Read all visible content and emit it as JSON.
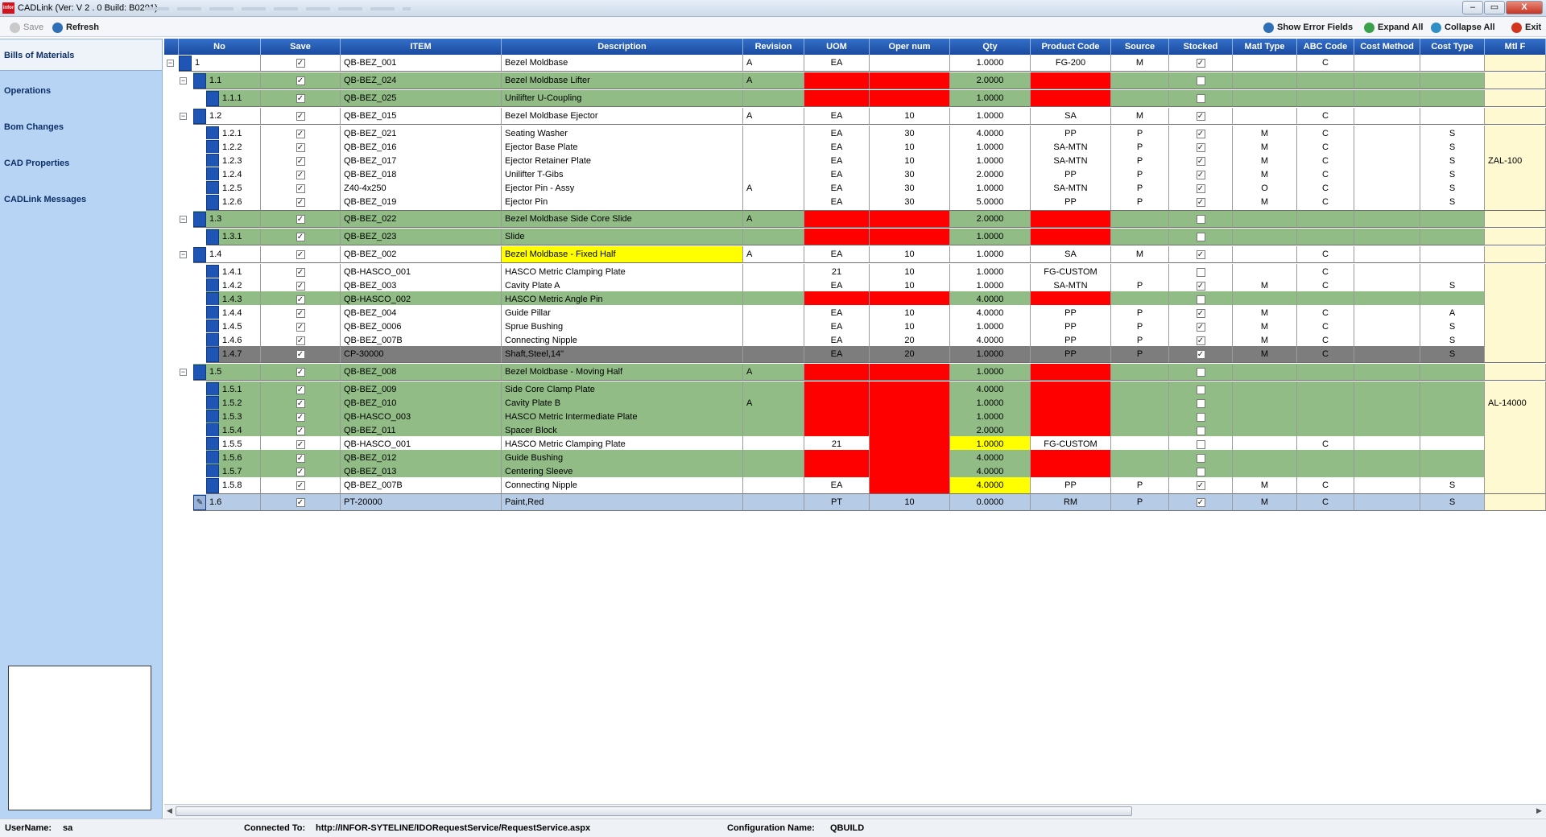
{
  "window": {
    "title": "CADLink  (Ver:  V 2 . 0 Build:  B0201)",
    "logo": "infor",
    "close_label": "X"
  },
  "toolbar": {
    "save": "Save",
    "refresh": "Refresh",
    "show_errors": "Show Error Fields",
    "expand_all": "Expand All",
    "collapse_all": "Collapse All",
    "exit": "Exit"
  },
  "sidebar": {
    "items": [
      "Bills of Materials",
      "Operations",
      "Bom Changes",
      "CAD Properties",
      "CADLink Messages"
    ]
  },
  "columns": [
    "No",
    "Save",
    "ITEM",
    "Description",
    "Revision",
    "UOM",
    "Oper num",
    "Qty",
    "Product Code",
    "Source",
    "Stocked",
    "Matl Type",
    "ABC Code",
    "Cost Method",
    "Cost Type",
    "Mtl F"
  ],
  "rows": [
    {
      "no": "1",
      "lvl": 0,
      "exp": "−",
      "save": true,
      "item": "QB-BEZ_001",
      "desc": "Bezel Moldbase",
      "rev": "A",
      "uom": "EA",
      "oper": "",
      "qty": "1.0000",
      "prod": "FG-200",
      "src": "M",
      "stk": true,
      "matl": "",
      "abc": "C",
      "cm": "",
      "ct": "",
      "mtl": "",
      "bg": "w",
      "err": []
    },
    {
      "no": "1.1",
      "lvl": 1,
      "exp": "−",
      "save": true,
      "item": "QB-BEZ_024",
      "desc": "Bezel Moldbase Lifter",
      "rev": "A",
      "uom": "",
      "oper": "",
      "qty": "2.0000",
      "prod": "",
      "src": "",
      "stk": false,
      "matl": "",
      "abc": "",
      "cm": "",
      "ct": "",
      "mtl": "",
      "bg": "g",
      "err": [
        "uom",
        "oper",
        "prod"
      ]
    },
    {
      "no": "1.1.1",
      "lvl": 2,
      "exp": "",
      "save": true,
      "item": "QB-BEZ_025",
      "desc": "Unilifter U-Coupling",
      "rev": "",
      "uom": "",
      "oper": "",
      "qty": "1.0000",
      "prod": "",
      "src": "",
      "stk": false,
      "matl": "",
      "abc": "",
      "cm": "",
      "ct": "",
      "mtl": "",
      "bg": "g",
      "err": [
        "uom",
        "oper",
        "prod"
      ]
    },
    {
      "no": "1.2",
      "lvl": 1,
      "exp": "−",
      "save": true,
      "item": "QB-BEZ_015",
      "desc": "Bezel Moldbase Ejector",
      "rev": "A",
      "uom": "EA",
      "oper": "10",
      "qty": "1.0000",
      "prod": "SA",
      "src": "M",
      "stk": true,
      "matl": "",
      "abc": "C",
      "cm": "",
      "ct": "",
      "mtl": "",
      "bg": "w",
      "err": []
    },
    {
      "no": "1.2.1",
      "lvl": 2,
      "exp": "",
      "save": true,
      "item": "QB-BEZ_021",
      "desc": "Seating Washer",
      "rev": "",
      "uom": "EA",
      "oper": "30",
      "qty": "4.0000",
      "prod": "PP",
      "src": "P",
      "stk": true,
      "matl": "M",
      "abc": "C",
      "cm": "",
      "ct": "S",
      "mtl": "",
      "bg": "w",
      "err": []
    },
    {
      "no": "1.2.2",
      "lvl": 2,
      "exp": "",
      "save": true,
      "item": "QB-BEZ_016",
      "desc": "Ejector Base Plate",
      "rev": "",
      "uom": "EA",
      "oper": "10",
      "qty": "1.0000",
      "prod": "SA-MTN",
      "src": "P",
      "stk": true,
      "matl": "M",
      "abc": "C",
      "cm": "",
      "ct": "S",
      "mtl": "",
      "bg": "w",
      "err": []
    },
    {
      "no": "1.2.3",
      "lvl": 2,
      "exp": "",
      "save": true,
      "item": "QB-BEZ_017",
      "desc": "Ejector Retainer Plate",
      "rev": "",
      "uom": "EA",
      "oper": "10",
      "qty": "1.0000",
      "prod": "SA-MTN",
      "src": "P",
      "stk": true,
      "matl": "M",
      "abc": "C",
      "cm": "",
      "ct": "S",
      "mtl": "ZAL-100",
      "bg": "w",
      "err": []
    },
    {
      "no": "1.2.4",
      "lvl": 2,
      "exp": "",
      "save": true,
      "item": "QB-BEZ_018",
      "desc": "Unilifter T-Gibs",
      "rev": "",
      "uom": "EA",
      "oper": "30",
      "qty": "2.0000",
      "prod": "PP",
      "src": "P",
      "stk": true,
      "matl": "M",
      "abc": "C",
      "cm": "",
      "ct": "S",
      "mtl": "",
      "bg": "w",
      "err": []
    },
    {
      "no": "1.2.5",
      "lvl": 2,
      "exp": "",
      "save": true,
      "item": "Z40-4x250",
      "desc": "Ejector Pin - Assy",
      "rev": "A",
      "uom": "EA",
      "oper": "30",
      "qty": "1.0000",
      "prod": "SA-MTN",
      "src": "P",
      "stk": true,
      "matl": "O",
      "abc": "C",
      "cm": "",
      "ct": "S",
      "mtl": "",
      "bg": "w",
      "err": []
    },
    {
      "no": "1.2.6",
      "lvl": 2,
      "exp": "",
      "save": true,
      "item": "QB-BEZ_019",
      "desc": "Ejector Pin",
      "rev": "",
      "uom": "EA",
      "oper": "30",
      "qty": "5.0000",
      "prod": "PP",
      "src": "P",
      "stk": true,
      "matl": "M",
      "abc": "C",
      "cm": "",
      "ct": "S",
      "mtl": "",
      "bg": "w",
      "err": []
    },
    {
      "no": "1.3",
      "lvl": 1,
      "exp": "−",
      "save": true,
      "item": "QB-BEZ_022",
      "desc": "Bezel Moldbase Side Core Slide",
      "rev": "A",
      "uom": "",
      "oper": "",
      "qty": "2.0000",
      "prod": "",
      "src": "",
      "stk": false,
      "matl": "",
      "abc": "",
      "cm": "",
      "ct": "",
      "mtl": "",
      "bg": "g",
      "err": [
        "uom",
        "oper",
        "prod"
      ]
    },
    {
      "no": "1.3.1",
      "lvl": 2,
      "exp": "",
      "save": true,
      "item": "QB-BEZ_023",
      "desc": "Slide",
      "rev": "",
      "uom": "",
      "oper": "",
      "qty": "1.0000",
      "prod": "",
      "src": "",
      "stk": false,
      "matl": "",
      "abc": "",
      "cm": "",
      "ct": "",
      "mtl": "",
      "bg": "g",
      "err": [
        "uom",
        "oper",
        "prod"
      ]
    },
    {
      "no": "1.4",
      "lvl": 1,
      "exp": "−",
      "save": true,
      "item": "QB-BEZ_002",
      "desc": "Bezel Moldbase - Fixed Half",
      "rev": "A",
      "uom": "EA",
      "oper": "10",
      "qty": "1.0000",
      "prod": "SA",
      "src": "M",
      "stk": true,
      "matl": "",
      "abc": "C",
      "cm": "",
      "ct": "",
      "mtl": "",
      "bg": "w",
      "err": [],
      "yel": [
        "desc"
      ]
    },
    {
      "no": "1.4.1",
      "lvl": 2,
      "exp": "",
      "save": true,
      "item": "QB-HASCO_001",
      "desc": "HASCO Metric Clamping Plate",
      "rev": "",
      "uom": "21",
      "oper": "10",
      "qty": "1.0000",
      "prod": "FG-CUSTOM",
      "src": "",
      "stk": false,
      "matl": "",
      "abc": "C",
      "cm": "",
      "ct": "",
      "mtl": "",
      "bg": "w",
      "err": []
    },
    {
      "no": "1.4.2",
      "lvl": 2,
      "exp": "",
      "save": true,
      "item": "QB-BEZ_003",
      "desc": "Cavity Plate A",
      "rev": "",
      "uom": "EA",
      "oper": "10",
      "qty": "1.0000",
      "prod": "SA-MTN",
      "src": "P",
      "stk": true,
      "matl": "M",
      "abc": "C",
      "cm": "",
      "ct": "S",
      "mtl": "",
      "bg": "w",
      "err": []
    },
    {
      "no": "1.4.3",
      "lvl": 2,
      "exp": "",
      "save": true,
      "item": "QB-HASCO_002",
      "desc": "HASCO Metric Angle Pin",
      "rev": "",
      "uom": "",
      "oper": "",
      "qty": "4.0000",
      "prod": "",
      "src": "",
      "stk": false,
      "matl": "",
      "abc": "",
      "cm": "",
      "ct": "",
      "mtl": "",
      "bg": "g",
      "err": [
        "uom",
        "oper",
        "prod"
      ]
    },
    {
      "no": "1.4.4",
      "lvl": 2,
      "exp": "",
      "save": true,
      "item": "QB-BEZ_004",
      "desc": "Guide Pillar",
      "rev": "",
      "uom": "EA",
      "oper": "10",
      "qty": "4.0000",
      "prod": "PP",
      "src": "P",
      "stk": true,
      "matl": "M",
      "abc": "C",
      "cm": "",
      "ct": "A",
      "mtl": "",
      "bg": "w",
      "err": []
    },
    {
      "no": "1.4.5",
      "lvl": 2,
      "exp": "",
      "save": true,
      "item": "QB-BEZ_0006",
      "desc": "Sprue Bushing",
      "rev": "",
      "uom": "EA",
      "oper": "10",
      "qty": "1.0000",
      "prod": "PP",
      "src": "P",
      "stk": true,
      "matl": "M",
      "abc": "C",
      "cm": "",
      "ct": "S",
      "mtl": "",
      "bg": "w",
      "err": []
    },
    {
      "no": "1.4.6",
      "lvl": 2,
      "exp": "",
      "save": true,
      "item": "QB-BEZ_007B",
      "desc": "Connecting Nipple",
      "rev": "",
      "uom": "EA",
      "oper": "20",
      "qty": "4.0000",
      "prod": "PP",
      "src": "P",
      "stk": true,
      "matl": "M",
      "abc": "C",
      "cm": "",
      "ct": "S",
      "mtl": "",
      "bg": "w",
      "err": []
    },
    {
      "no": "1.4.7",
      "lvl": 2,
      "exp": "",
      "save": true,
      "item": "CP-30000",
      "desc": "Shaft,Steel,14\"",
      "rev": "",
      "uom": "EA",
      "oper": "20",
      "qty": "1.0000",
      "prod": "PP",
      "src": "P",
      "stk": true,
      "matl": "M",
      "abc": "C",
      "cm": "",
      "ct": "S",
      "mtl": "",
      "bg": "d",
      "err": []
    },
    {
      "no": "1.5",
      "lvl": 1,
      "exp": "−",
      "save": true,
      "item": "QB-BEZ_008",
      "desc": "Bezel Moldbase - Moving Half",
      "rev": "A",
      "uom": "",
      "oper": "",
      "qty": "1.0000",
      "prod": "",
      "src": "",
      "stk": false,
      "matl": "",
      "abc": "",
      "cm": "",
      "ct": "",
      "mtl": "",
      "bg": "g",
      "err": [
        "uom",
        "oper",
        "prod"
      ]
    },
    {
      "no": "1.5.1",
      "lvl": 2,
      "exp": "",
      "save": true,
      "item": "QB-BEZ_009",
      "desc": "Side Core Clamp Plate",
      "rev": "",
      "uom": "",
      "oper": "",
      "qty": "4.0000",
      "prod": "",
      "src": "",
      "stk": false,
      "matl": "",
      "abc": "",
      "cm": "",
      "ct": "",
      "mtl": "",
      "bg": "g",
      "err": [
        "uom",
        "oper",
        "prod"
      ]
    },
    {
      "no": "1.5.2",
      "lvl": 2,
      "exp": "",
      "save": true,
      "item": "QB-BEZ_010",
      "desc": "Cavity Plate B",
      "rev": "A",
      "uom": "",
      "oper": "",
      "qty": "1.0000",
      "prod": "",
      "src": "",
      "stk": false,
      "matl": "",
      "abc": "",
      "cm": "",
      "ct": "",
      "mtl": "AL-14000",
      "bg": "g",
      "err": [
        "uom",
        "oper",
        "prod"
      ]
    },
    {
      "no": "1.5.3",
      "lvl": 2,
      "exp": "",
      "save": true,
      "item": "QB-HASCO_003",
      "desc": "HASCO Metric Intermediate Plate",
      "rev": "",
      "uom": "",
      "oper": "",
      "qty": "1.0000",
      "prod": "",
      "src": "",
      "stk": false,
      "matl": "",
      "abc": "",
      "cm": "",
      "ct": "",
      "mtl": "",
      "bg": "g",
      "err": [
        "uom",
        "oper",
        "prod"
      ]
    },
    {
      "no": "1.5.4",
      "lvl": 2,
      "exp": "",
      "save": true,
      "item": "QB-BEZ_011",
      "desc": "Spacer Block",
      "rev": "",
      "uom": "",
      "oper": "",
      "qty": "2.0000",
      "prod": "",
      "src": "",
      "stk": false,
      "matl": "",
      "abc": "",
      "cm": "",
      "ct": "",
      "mtl": "",
      "bg": "g",
      "err": [
        "uom",
        "oper",
        "prod"
      ]
    },
    {
      "no": "1.5.5",
      "lvl": 2,
      "exp": "",
      "save": true,
      "item": "QB-HASCO_001",
      "desc": "HASCO Metric Clamping Plate",
      "rev": "",
      "uom": "21",
      "oper": "",
      "qty": "1.0000",
      "prod": "FG-CUSTOM",
      "src": "",
      "stk": false,
      "matl": "",
      "abc": "C",
      "cm": "",
      "ct": "",
      "mtl": "",
      "bg": "w",
      "err": [
        "oper"
      ],
      "yel": [
        "qty"
      ]
    },
    {
      "no": "1.5.6",
      "lvl": 2,
      "exp": "",
      "save": true,
      "item": "QB-BEZ_012",
      "desc": "Guide Bushing",
      "rev": "",
      "uom": "",
      "oper": "",
      "qty": "4.0000",
      "prod": "",
      "src": "",
      "stk": false,
      "matl": "",
      "abc": "",
      "cm": "",
      "ct": "",
      "mtl": "",
      "bg": "g",
      "err": [
        "uom",
        "oper",
        "prod"
      ]
    },
    {
      "no": "1.5.7",
      "lvl": 2,
      "exp": "",
      "save": true,
      "item": "QB-BEZ_013",
      "desc": "Centering Sleeve",
      "rev": "",
      "uom": "",
      "oper": "",
      "qty": "4.0000",
      "prod": "",
      "src": "",
      "stk": false,
      "matl": "",
      "abc": "",
      "cm": "",
      "ct": "",
      "mtl": "",
      "bg": "g",
      "err": [
        "uom",
        "oper",
        "prod"
      ]
    },
    {
      "no": "1.5.8",
      "lvl": 2,
      "exp": "",
      "save": true,
      "item": "QB-BEZ_007B",
      "desc": "Connecting Nipple",
      "rev": "",
      "uom": "EA",
      "oper": "",
      "qty": "4.0000",
      "prod": "PP",
      "src": "P",
      "stk": true,
      "matl": "M",
      "abc": "C",
      "cm": "",
      "ct": "S",
      "mtl": "",
      "bg": "w",
      "err": [
        "oper"
      ],
      "yel": [
        "qty"
      ]
    },
    {
      "no": "1.6",
      "lvl": 1,
      "exp": "",
      "save": true,
      "item": "PT-20000",
      "desc": "Paint,Red",
      "rev": "",
      "uom": "PT",
      "oper": "10",
      "qty": "0.0000",
      "prod": "RM",
      "src": "P",
      "stk": true,
      "matl": "M",
      "abc": "C",
      "cm": "",
      "ct": "S",
      "mtl": "",
      "bg": "b",
      "err": [],
      "editing": true
    }
  ],
  "status": {
    "user_label": "UserName:",
    "user": "sa",
    "conn_label": "Connected To:",
    "conn": "http://INFOR-SYTELINE/IDORequestService/RequestService.aspx",
    "cfg_label": "Configuration Name:",
    "cfg": "QBUILD"
  },
  "colors": {
    "header": "#1f55b5",
    "green": "#91bc86",
    "error": "#ff0000",
    "warning": "#ffff00",
    "sidebar": "#b8d4f4"
  }
}
